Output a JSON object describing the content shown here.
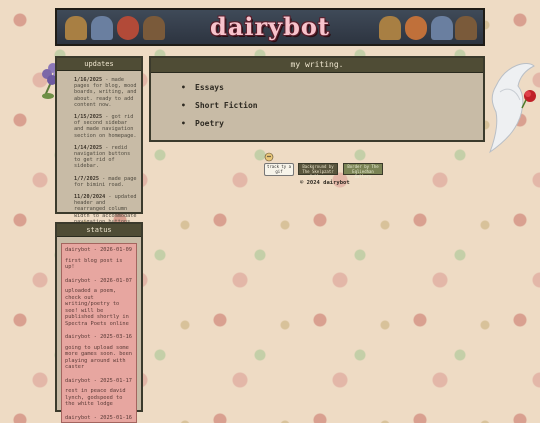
{
  "banner": {
    "title": "dairybot"
  },
  "updates": {
    "heading": "updates",
    "entries": [
      {
        "date": "1/16/2025",
        "text": "- made pages for blog, mood boards, writing, and about. ready to add content now."
      },
      {
        "date": "1/15/2025",
        "text": "- got rid of second sidebar and made navigation section on homepage."
      },
      {
        "date": "1/14/2025",
        "text": "- redid navigation buttons to get rid of sidebar."
      },
      {
        "date": "1/7/2025",
        "text": "- made page for bimini road."
      },
      {
        "date": "11/20/2024",
        "text": "- updated header and rearranged column width to accommodate navigation buttons."
      }
    ]
  },
  "status": {
    "heading": "status",
    "entries": [
      {
        "meta": "dairybot - 2026-01-09",
        "text": "first blog post is up!"
      },
      {
        "meta": "dairybot - 2026-01-07",
        "text": "uploaded a poem, check out writing/poetry to see! will be published shortly in Spectra Poets online"
      },
      {
        "meta": "dairybot - 2025-03-16",
        "text": "going to upload some more games soon. been playing around with caster"
      },
      {
        "meta": "dairybot - 2025-01-17",
        "text": "rest in peace david lynch, godspeed to the white lodge"
      },
      {
        "meta": "dairybot - 2025-01-16",
        "text": ""
      }
    ]
  },
  "main": {
    "heading": "my writing.",
    "links": [
      "Essays",
      "Short Fiction",
      "Poetry"
    ]
  },
  "footer": {
    "track_badge": "track ty a gif",
    "background_badge": "Background by The Skelpzatr Gallery",
    "border_badge": "Border by The Eqliedhan Gallery",
    "copyright": "© 2024 dairybot"
  }
}
